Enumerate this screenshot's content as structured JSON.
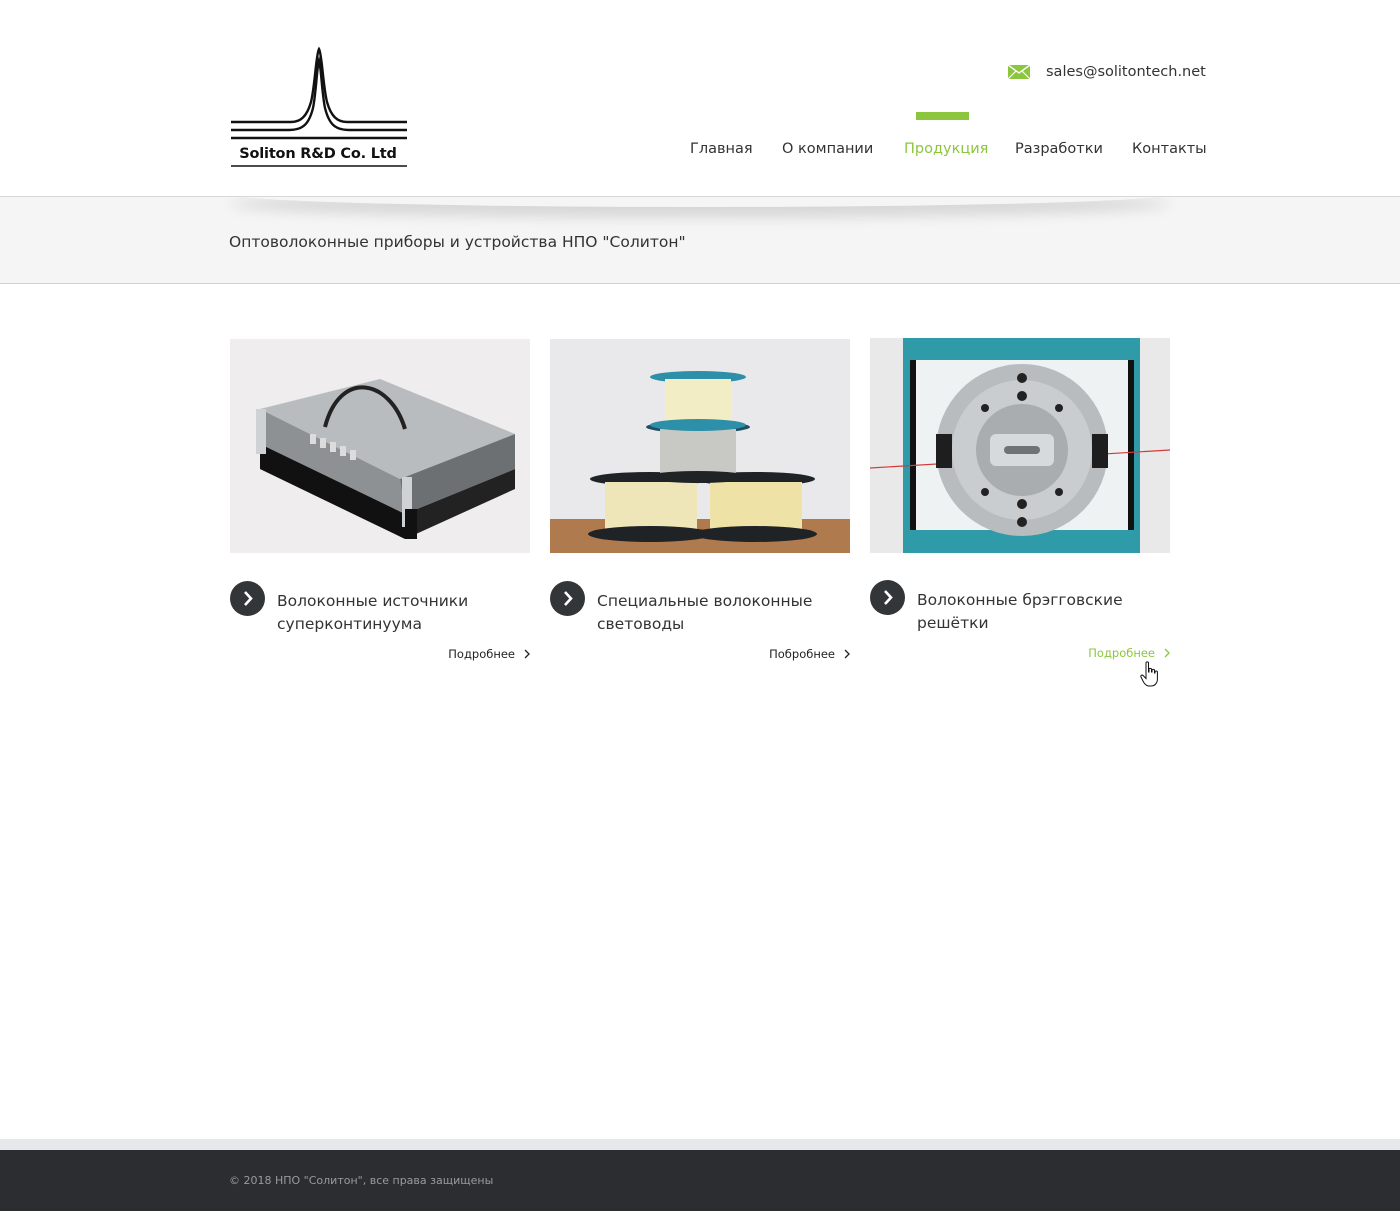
{
  "header": {
    "logo_text": "Soliton R&D Co. Ltd",
    "email": "sales@solitontech.net",
    "accent_color": "#8cc63f"
  },
  "nav": {
    "items": [
      {
        "label": "Главная",
        "active": false
      },
      {
        "label": "О компании",
        "active": false
      },
      {
        "label": "Продукция",
        "active": true
      },
      {
        "label": "Разработки",
        "active": false
      },
      {
        "label": "Контакты",
        "active": false
      }
    ]
  },
  "band": {
    "title": "Оптоволоконные приборы и устройства НПО \"Солитон\""
  },
  "products": [
    {
      "title": "Волоконные источники суперконтинуума",
      "more": "Подробнее",
      "image": "rack-device-image"
    },
    {
      "title": "Специальные волоконные световоды",
      "more": "Побробнее",
      "image": "fiber-spools-image"
    },
    {
      "title": "Волоконные брэгговские решётки",
      "more": "Подробнее",
      "image": "bragg-grating-image",
      "hovered": true
    }
  ],
  "footer": {
    "copyright": "© 2018 НПО \"Солитон\", все права защищены"
  }
}
